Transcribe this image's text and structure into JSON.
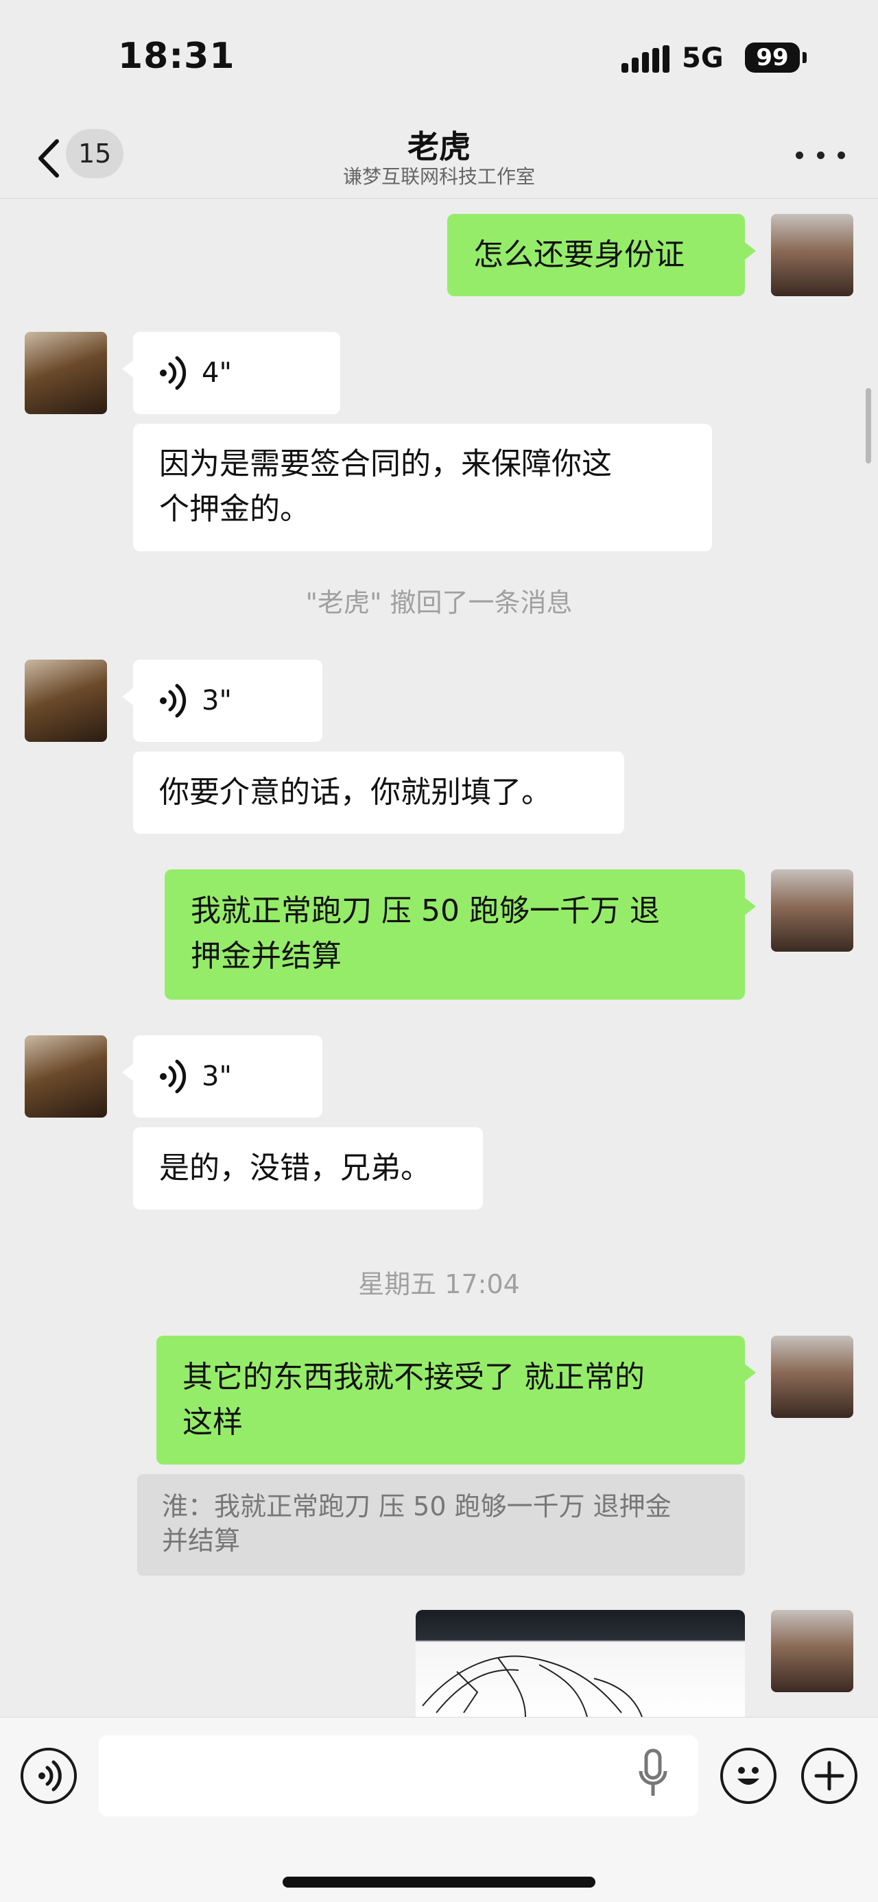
{
  "status_bar": {
    "time": "18:31",
    "network": "5G",
    "battery": "99"
  },
  "nav": {
    "back_icon": "chevron-left-icon",
    "unread_count": "15",
    "title": "老虎",
    "subtitle": "谦梦互联网科技工作室",
    "more_icon": "more-dots-icon"
  },
  "messages": [
    {
      "sender": "me",
      "type": "text",
      "text": "怎么还要身份证"
    },
    {
      "sender": "contact",
      "type": "voice",
      "duration": "4\""
    },
    {
      "sender": "contact",
      "type": "text",
      "lines": [
        "因为是需要签合同的，来保障你这",
        "个押金的。"
      ]
    },
    {
      "sender": "system",
      "type": "notice",
      "text": "\"老虎\" 撤回了一条消息"
    },
    {
      "sender": "contact",
      "type": "voice",
      "duration": "3\""
    },
    {
      "sender": "contact",
      "type": "text",
      "text": "你要介意的话，你就别填了。"
    },
    {
      "sender": "me",
      "type": "text",
      "lines": [
        "我就正常跑刀 压 50 跑够一千万 退",
        "押金并结算"
      ]
    },
    {
      "sender": "contact",
      "type": "voice",
      "duration": "3\""
    },
    {
      "sender": "contact",
      "type": "text",
      "text": "是的，没错，兄弟。"
    },
    {
      "sender": "system",
      "type": "timestamp",
      "text": "星期五 17:04"
    },
    {
      "sender": "me",
      "type": "text",
      "lines": [
        "其它的东西我就不接受了 就正常的",
        "这样"
      ]
    },
    {
      "sender": "me",
      "type": "quote",
      "lines": [
        "淮：我就正常跑刀 压 50 跑够一千万 退押金",
        "并结算"
      ]
    },
    {
      "sender": "me",
      "type": "image"
    }
  ],
  "input_bar": {
    "voice_icon": "voice-mode-icon",
    "mic_icon": "microphone-icon",
    "emoji_icon": "emoji-icon",
    "add_icon": "plus-icon"
  },
  "colors": {
    "background": "#ededed",
    "outgoing_bubble": "#95ec69",
    "incoming_bubble": "#ffffff",
    "system_text": "#a0a0a0"
  }
}
